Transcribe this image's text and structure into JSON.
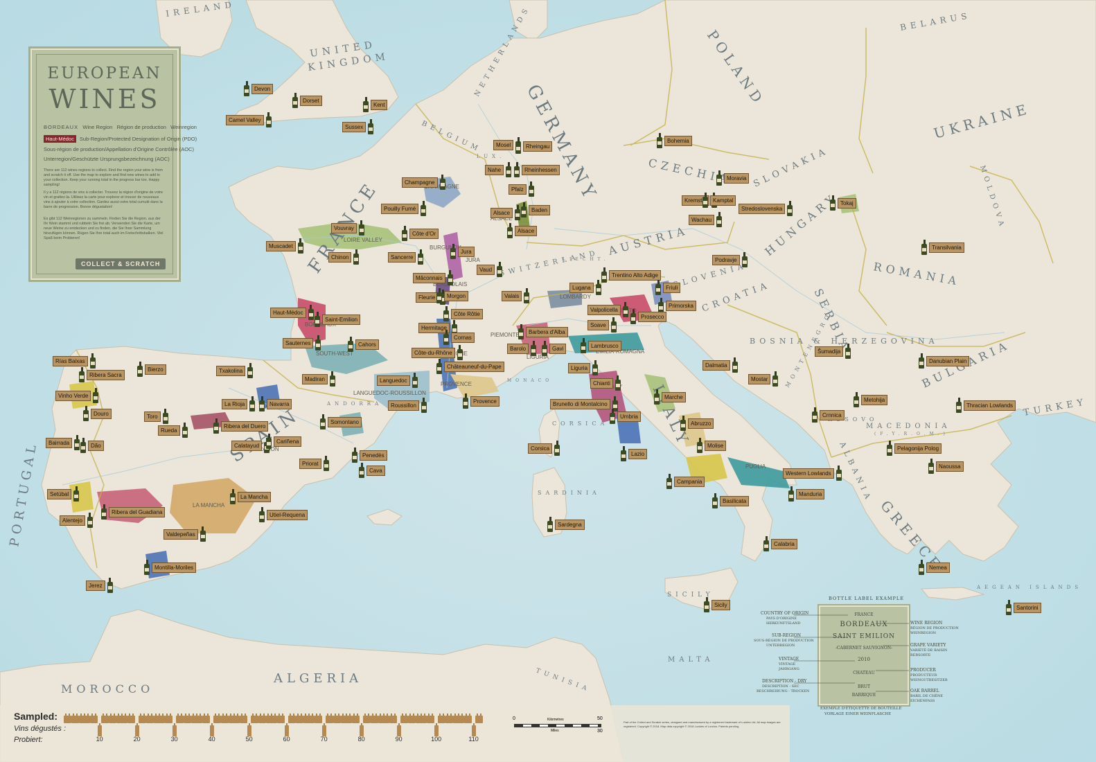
{
  "legend": {
    "title_line1": "EUROPEAN",
    "title_line2": "WINES",
    "row1_a": "BORDEAUX",
    "row1_b": "Wine Region",
    "row1_c": "Région de production",
    "row1_d": "Weinregion",
    "row2_chip": "Haut-Médoc",
    "row2_text": "Sub-Region/Protected Designation of Origin (PDO)",
    "row3_text": "Sous-région de production/Appellation d'Origine Contrôlée (AOC)",
    "row4_text": "Unterregion/Geschützte Ursprungsbezeichnung (AOC)",
    "para_en": "There are 112 wines regions to collect. Find the region your wine is from and scratch it off. Use the map to explore and find new wines to add to your collection. Keep your running total in the progress bar too. Happy sampling!",
    "para_fr": "Il y a 112 régions de vins à collecter. Trouvez la région d'origine de votre vin et grattez-la. Utilisez la carte pour explorer et trouver de nouveaux vins à ajouter à votre collection. Gardez aussi votre total cumulé dans la barre de progression. Bonne dégustation!",
    "para_de": "Es gibt 112 Weinregionen zu sammeln. Finden Sie die Region, aus der Ihr Wein stammt und rubbeln Sie frei ab. Verwenden Sie die Karte, um neue Weine zu entdecken und zu finden, die Sie Ihrer Sammlung hinzufügen können. Rügen Sie Ihre total auch im Fortschrittsbalken. Viel Spaß beim Probieren!",
    "badge": "COLLECT & SCRATCH"
  },
  "countries": [
    {
      "label": "IRELAND",
      "size": 12
    },
    {
      "label": "UNITED",
      "size": 14
    },
    {
      "label": "KINGDOM",
      "size": 14
    },
    {
      "label": "NETHERLANDS",
      "size": 10
    },
    {
      "label": "BELGIUM",
      "size": 10
    },
    {
      "label": "LUX.",
      "size": 7
    },
    {
      "label": "GERMANY",
      "size": 26
    },
    {
      "label": "POLAND",
      "size": 20
    },
    {
      "label": "BELARUS",
      "size": 12
    },
    {
      "label": "UKRAINE",
      "size": 20
    },
    {
      "label": "MOLDOVA",
      "size": 10
    },
    {
      "label": "CZECHIA",
      "size": 16
    },
    {
      "label": "SLOVAKIA",
      "size": 13
    },
    {
      "label": "HUNGARY",
      "size": 16
    },
    {
      "label": "ROMANIA",
      "size": 16
    },
    {
      "label": "AUSTRIA",
      "size": 16
    },
    {
      "label": "SWITZERLAND",
      "size": 10
    },
    {
      "label": "LIECHT.",
      "size": 6
    },
    {
      "label": "SLOVENIA",
      "size": 11
    },
    {
      "label": "CROATIA",
      "size": 13
    },
    {
      "label": "BOSNIA & HERZEGOVINA",
      "size": 11
    },
    {
      "label": "SERBIA",
      "size": 16
    },
    {
      "label": "MONTENEGRO",
      "size": 8
    },
    {
      "label": "KOSOVO",
      "size": 8
    },
    {
      "label": "ALBANIA",
      "size": 11
    },
    {
      "label": "MACEDONIA",
      "size": 10
    },
    {
      "label": "(F.Y.R.O.M.)",
      "size": 6
    },
    {
      "label": "BULGARIA",
      "size": 16
    },
    {
      "label": "TURKEY",
      "size": 13
    },
    {
      "label": "GREECE",
      "size": 20
    },
    {
      "label": "FRANCE",
      "size": 26
    },
    {
      "label": "ITALY",
      "size": 22
    },
    {
      "label": "SPAIN",
      "size": 26
    },
    {
      "label": "PORTUGAL",
      "size": 18
    },
    {
      "label": "ANDORRA",
      "size": 7
    },
    {
      "label": "MONACO",
      "size": 6
    },
    {
      "label": "CORSICA",
      "size": 8
    },
    {
      "label": "SARDINIA",
      "size": 8
    },
    {
      "label": "SICILY",
      "size": 9
    },
    {
      "label": "MALTA",
      "size": 10
    },
    {
      "label": "MOROCCO",
      "size": 16
    },
    {
      "label": "ALGERIA",
      "size": 18
    },
    {
      "label": "TUNISIA",
      "size": 9
    },
    {
      "label": "AEGEAN ISLANDS",
      "size": 7
    }
  ],
  "sub_labels": [
    "CHAMPAGNE",
    "ALSACE",
    "BURGUNDY",
    "LOIRE VALLEY",
    "JURA",
    "BEAUJOLAIS",
    "BORDEAUX",
    "SOUTH-WEST",
    "RHONE",
    "LANGUEDOC-ROUSSILLON",
    "PROVENCE",
    "LIGURIA",
    "PIEMONTE",
    "LOMBARDY",
    "VENETO",
    "EMILIA-ROMAGNA",
    "TUSCANY",
    "PUGLIA",
    "LA RIOJA",
    "ARAGON",
    "LA MANCHA"
  ],
  "regions": [
    {
      "name": "Devon"
    },
    {
      "name": "Dorset"
    },
    {
      "name": "Kent"
    },
    {
      "name": "Camel Valley"
    },
    {
      "name": "Sussex"
    },
    {
      "name": "Mosel"
    },
    {
      "name": "Rheingau"
    },
    {
      "name": "Nahe"
    },
    {
      "name": "Rheinhessen"
    },
    {
      "name": "Pfalz"
    },
    {
      "name": "Baden"
    },
    {
      "name": "Champagne"
    },
    {
      "name": "Alsace"
    },
    {
      "name": "Alsace"
    },
    {
      "name": "Pouilly Fumé"
    },
    {
      "name": "Vouvray"
    },
    {
      "name": "Côte d'Or"
    },
    {
      "name": "Muscadet"
    },
    {
      "name": "Chinon"
    },
    {
      "name": "Sancerre"
    },
    {
      "name": "Jura"
    },
    {
      "name": "Vaud"
    },
    {
      "name": "Bohemia"
    },
    {
      "name": "Moravia"
    },
    {
      "name": "Kremstal"
    },
    {
      "name": "Kamptal"
    },
    {
      "name": "Wachau"
    },
    {
      "name": "Tokaj"
    },
    {
      "name": "Stredoslovenska"
    },
    {
      "name": "Mâconnais"
    },
    {
      "name": "Fleurie"
    },
    {
      "name": "Morgon"
    },
    {
      "name": "Valais"
    },
    {
      "name": "Lugana"
    },
    {
      "name": "Trentino Alto Adige"
    },
    {
      "name": "Friuli"
    },
    {
      "name": "Podravje"
    },
    {
      "name": "Primorska"
    },
    {
      "name": "Transilvania"
    },
    {
      "name": "Haut-Médoc"
    },
    {
      "name": "Saint-Emilion"
    },
    {
      "name": "Côte Rôtie"
    },
    {
      "name": "Valpolicella"
    },
    {
      "name": "Prosecco"
    },
    {
      "name": "Hermitage"
    },
    {
      "name": "Soave"
    },
    {
      "name": "Cornas"
    },
    {
      "name": "Sauternes"
    },
    {
      "name": "Cahors"
    },
    {
      "name": "Barbera d'Alba"
    },
    {
      "name": "Barolo"
    },
    {
      "name": "Gavi"
    },
    {
      "name": "Lambrusco"
    },
    {
      "name": "Côte-du-Rhône"
    },
    {
      "name": "Châteauneuf-du-Pape"
    },
    {
      "name": "Rías Baixas"
    },
    {
      "name": "Ribera Sacra"
    },
    {
      "name": "Bierzo"
    },
    {
      "name": "Txakolina"
    },
    {
      "name": "Madiran"
    },
    {
      "name": "Languedoc"
    },
    {
      "name": "Liguria"
    },
    {
      "name": "Chianti"
    },
    {
      "name": "Dalmatia"
    },
    {
      "name": "Šumadija"
    },
    {
      "name": "Danubian Plain"
    },
    {
      "name": "Vinho Verde"
    },
    {
      "name": "La Rioja"
    },
    {
      "name": "Navarra"
    },
    {
      "name": "Roussillon"
    },
    {
      "name": "Provence"
    },
    {
      "name": "Mostar"
    },
    {
      "name": "Brunello di Montalcino"
    },
    {
      "name": "Marche"
    },
    {
      "name": "Metohija"
    },
    {
      "name": "Douro"
    },
    {
      "name": "Toro"
    },
    {
      "name": "Ribera del Duero"
    },
    {
      "name": "Somontano"
    },
    {
      "name": "Rueda"
    },
    {
      "name": "Umbria"
    },
    {
      "name": "Crnnica"
    },
    {
      "name": "Thracian Lowlands"
    },
    {
      "name": "Abruzzo"
    },
    {
      "name": "Bairrada"
    },
    {
      "name": "Dão"
    },
    {
      "name": "Calatayud"
    },
    {
      "name": "Cariñena"
    },
    {
      "name": "Corsica"
    },
    {
      "name": "Molise"
    },
    {
      "name": "Penedès"
    },
    {
      "name": "Lazio"
    },
    {
      "name": "Pelagonija Polog"
    },
    {
      "name": "Priorat"
    },
    {
      "name": "Cava"
    },
    {
      "name": "Naoussa"
    },
    {
      "name": "Western Lowlands"
    },
    {
      "name": "Campania"
    },
    {
      "name": "Setúbal"
    },
    {
      "name": "Manduria"
    },
    {
      "name": "La Mancha"
    },
    {
      "name": "Ribera del Guadiana"
    },
    {
      "name": "Alentejo"
    },
    {
      "name": "Basilicata"
    },
    {
      "name": "Utiel-Requena"
    },
    {
      "name": "Sardegna"
    },
    {
      "name": "Valdepeñas"
    },
    {
      "name": "Calabria"
    },
    {
      "name": "Montilla-Moriles"
    },
    {
      "name": "Nemea"
    },
    {
      "name": "Jerez"
    },
    {
      "name": "Sicily"
    },
    {
      "name": "Santorini"
    }
  ],
  "progress": {
    "label_en": "Sampled:",
    "label_fr": "Vins dégustés :",
    "label_de": "Probiert:",
    "total": 112,
    "sampled": 0,
    "ticks": [
      "10",
      "20",
      "30",
      "40",
      "50",
      "60",
      "70",
      "80",
      "90",
      "100",
      "110"
    ]
  },
  "scale_bar": {
    "km_label": "Kilometres",
    "mi_label": "Miles",
    "km_start": "0",
    "km_end": "50",
    "mi_end": "30"
  },
  "credits": "Part of the Collect and Scratch series, designed and manufactured by a registered trademark of Luckies Ltd. All map images are registered. Copyright © 2018. Map data copyright © 2018 Luckies of London. Patents pending.",
  "bottle_example": {
    "title": "BOTTLE LABEL EXAMPLE",
    "card_country": "FRANCE",
    "card_region": "BORDEAUX",
    "card_subregion": "SAINT EMILION",
    "card_grape": "-CABERNET SAUVIGNON-",
    "card_vintage": "2010",
    "card_producer": "CHATEAU",
    "card_desc": "BRUT",
    "card_oak": "BARRIQUE",
    "left_1": "COUNTRY OF ORIGIN",
    "left_1b": "PAYS D'ORIGINE",
    "left_1c": "HERKUNFTSLAND",
    "left_2": "SUB-REGION",
    "left_2b": "SOUS-RÉGION DE PRODUCTION",
    "left_2c": "UNTERREGION",
    "left_3": "VINTAGE",
    "left_3b": "VINTAGE",
    "left_3c": "JAHRGANG",
    "left_4": "DESCRIPTION - DRY",
    "left_4b": "DESCRIPTION - SEC",
    "left_4c": "BESCHREIBUNG - TROCKEN",
    "right_1": "WINE REGION",
    "right_1b": "RÉGION DE PRODUCTION",
    "right_1c": "WEINREGION",
    "right_2": "GRAPE VARIETY",
    "right_2b": "VARIÉTÉ DE RAISIN",
    "right_2c": "REBSORTE",
    "right_3": "PRODUCER",
    "right_3b": "PRODUCTEUR",
    "right_3c": "WEINGUTBESITZER",
    "right_4": "OAK BARREL",
    "right_4b": "BARIL DE CHÊNE",
    "right_4c": "EICHENFASS",
    "foot_1": "EXEMPLE D'ÉTIQUETTE DE BOUTEILLE",
    "foot_2": "VORLAGE EINER WEINFLASCHE"
  }
}
